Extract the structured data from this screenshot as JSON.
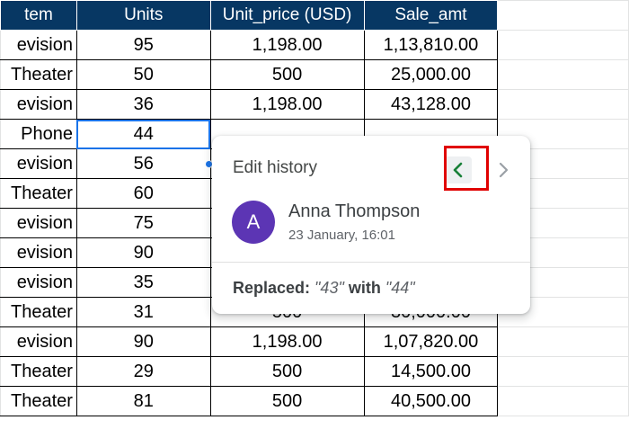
{
  "headers": {
    "item": "tem",
    "units": "Units",
    "unit_price": "Unit_price (USD)",
    "sale_amt": "Sale_amt"
  },
  "rows": [
    {
      "item": "evision",
      "units": "95",
      "unit_price": "1,198.00",
      "sale_amt": "1,13,810.00"
    },
    {
      "item": "Theater",
      "units": "50",
      "unit_price": "500",
      "sale_amt": "25,000.00"
    },
    {
      "item": "evision",
      "units": "36",
      "unit_price": "1,198.00",
      "sale_amt": "43,128.00"
    },
    {
      "item": "Phone",
      "units": "44",
      "unit_price": "",
      "sale_amt": ""
    },
    {
      "item": "evision",
      "units": "56",
      "unit_price": "",
      "sale_amt": ""
    },
    {
      "item": "Theater",
      "units": "60",
      "unit_price": "",
      "sale_amt": ""
    },
    {
      "item": "evision",
      "units": "75",
      "unit_price": "",
      "sale_amt": ""
    },
    {
      "item": "evision",
      "units": "90",
      "unit_price": "",
      "sale_amt": ""
    },
    {
      "item": "evision",
      "units": "35",
      "unit_price": "",
      "sale_amt": ""
    },
    {
      "item": "Theater",
      "units": "31",
      "unit_price": "500",
      "sale_amt": "30,000.00"
    },
    {
      "item": "evision",
      "units": "90",
      "unit_price": "1,198.00",
      "sale_amt": "1,07,820.00"
    },
    {
      "item": "Theater",
      "units": "29",
      "unit_price": "500",
      "sale_amt": "14,500.00"
    },
    {
      "item": "Theater",
      "units": "81",
      "unit_price": "500",
      "sale_amt": "40,500.00"
    }
  ],
  "selected_row": 3,
  "edit_history": {
    "title": "Edit history",
    "prev_icon": "chevron-left-icon",
    "next_icon": "chevron-right-icon",
    "user": {
      "initial": "A",
      "name": "Anna Thompson",
      "time": "23 January, 16:01"
    },
    "change": {
      "label": "Replaced:",
      "old": "\"43\"",
      "with": "with",
      "new": "\"44\""
    }
  },
  "colors": {
    "header_bg": "#073763",
    "selection": "#1a73e8",
    "avatar_bg": "#5c35b4",
    "nav_prev": "#188038",
    "highlight_box": "#e00000"
  }
}
